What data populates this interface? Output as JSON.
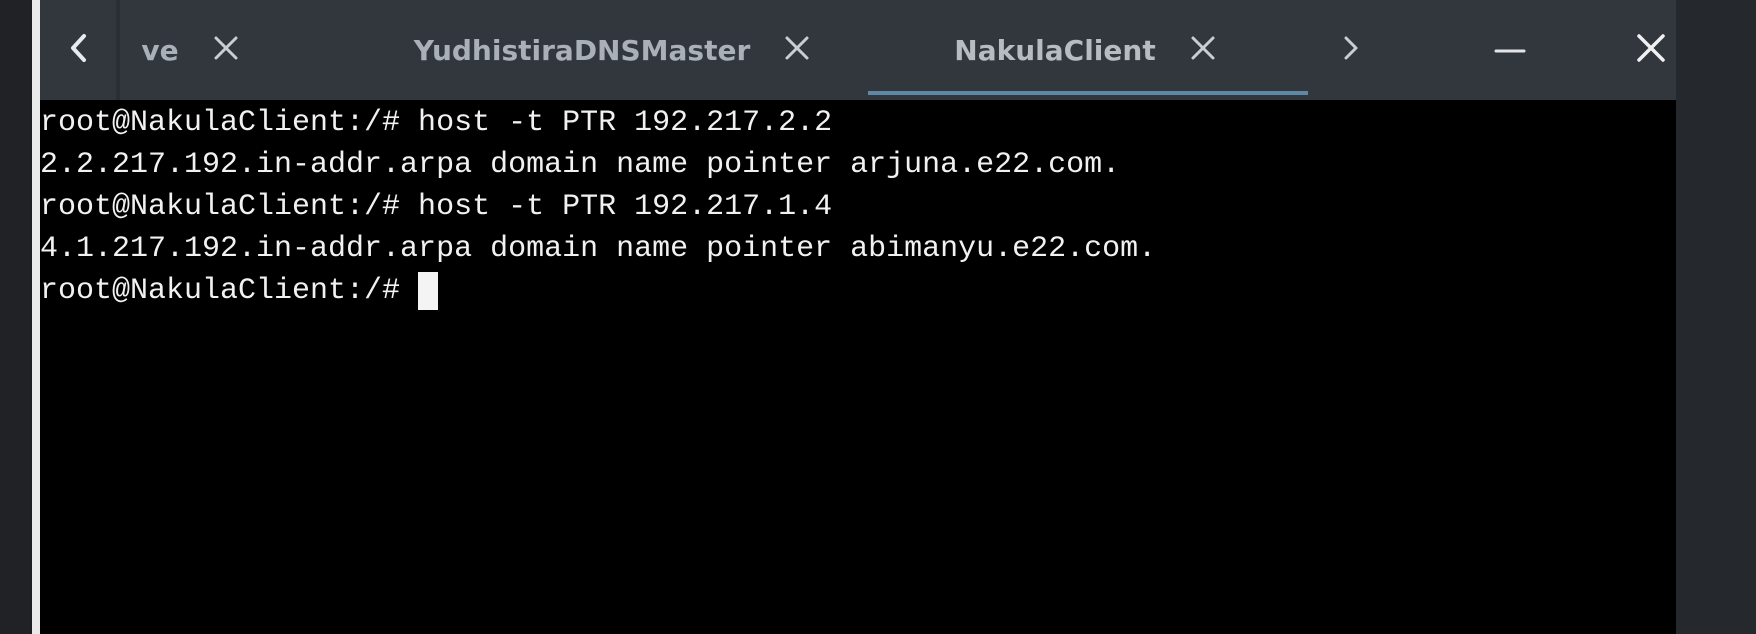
{
  "tabs": [
    {
      "label": "ve",
      "close_label": "×"
    },
    {
      "label": "YudhistiraDNSMaster",
      "close_label": "×"
    },
    {
      "label": "NakulaClient",
      "close_label": "×"
    }
  ],
  "controls": {
    "scroll_left": "‹",
    "scroll_right": "›",
    "minimize": "—",
    "close": "×"
  },
  "terminal": {
    "lines": [
      "root@NakulaClient:/# host -t PTR 192.217.2.2",
      "2.2.217.192.in-addr.arpa domain name pointer arjuna.e22.com.",
      "root@NakulaClient:/# host -t PTR 192.217.1.4",
      "4.1.217.192.in-addr.arpa domain name pointer abimanyu.e22.com."
    ],
    "prompt": "root@NakulaClient:/# "
  },
  "colors": {
    "tabbar_bg": "#32363d",
    "terminal_bg": "#000000",
    "terminal_fg": "#f1f1f1",
    "active_tab_indicator": "#5f88a6"
  },
  "icons": {
    "scroll_left": "chevron-left-icon",
    "scroll_right": "chevron-right-icon",
    "tab_close": "close-icon",
    "minimize": "minimize-icon",
    "window_close": "close-icon"
  }
}
